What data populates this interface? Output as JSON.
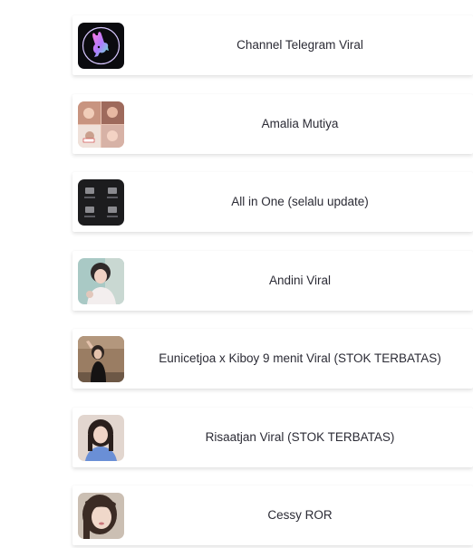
{
  "links": [
    {
      "label": "Channel Telegram Viral",
      "icon": "playboy-bunny-logo-icon"
    },
    {
      "label": "Amalia Mutiya",
      "icon": "photo-collage-thumbnail-icon"
    },
    {
      "label": "All in One (selalu update)",
      "icon": "folder-grid-thumbnail-icon"
    },
    {
      "label": "Andini Viral",
      "icon": "portrait-thumbnail-icon"
    },
    {
      "label": "Eunicetjoa x Kiboy 9 menit Viral (STOK TERBATAS)",
      "icon": "portrait-thumbnail-icon"
    },
    {
      "label": "Risaatjan Viral (STOK TERBATAS)",
      "icon": "portrait-thumbnail-icon"
    },
    {
      "label": "Cessy ROR",
      "icon": "portrait-thumbnail-icon"
    }
  ]
}
